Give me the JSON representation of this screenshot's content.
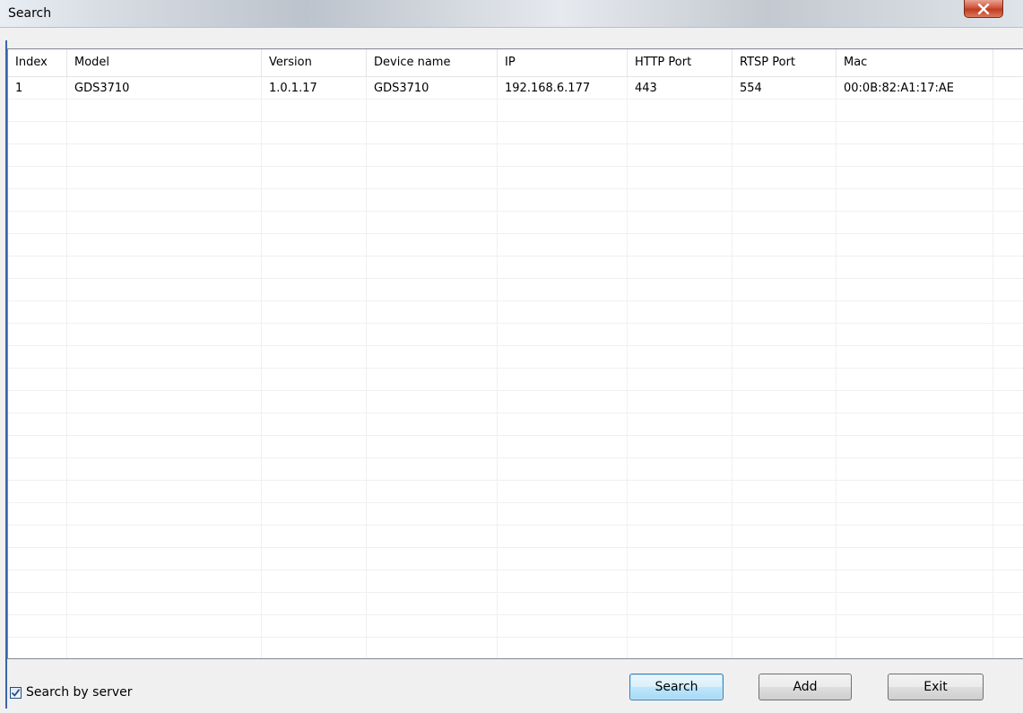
{
  "window": {
    "title": "Search",
    "close_label": "X"
  },
  "list": {
    "columns": [
      "Index",
      "Model",
      "Version",
      "Device name",
      "IP",
      "HTTP Port",
      "RTSP Port",
      "Mac"
    ],
    "rows": [
      [
        "1",
        "GDS3710",
        "1.0.1.17",
        "GDS3710",
        "192.168.6.177",
        "443",
        "554",
        "00:0B:82:A1:17:AE"
      ]
    ]
  },
  "footer": {
    "search_by_server_label": "Search by server",
    "search_by_server_checked": true,
    "search_button": "Search",
    "add_button": "Add",
    "exit_button": "Exit"
  }
}
